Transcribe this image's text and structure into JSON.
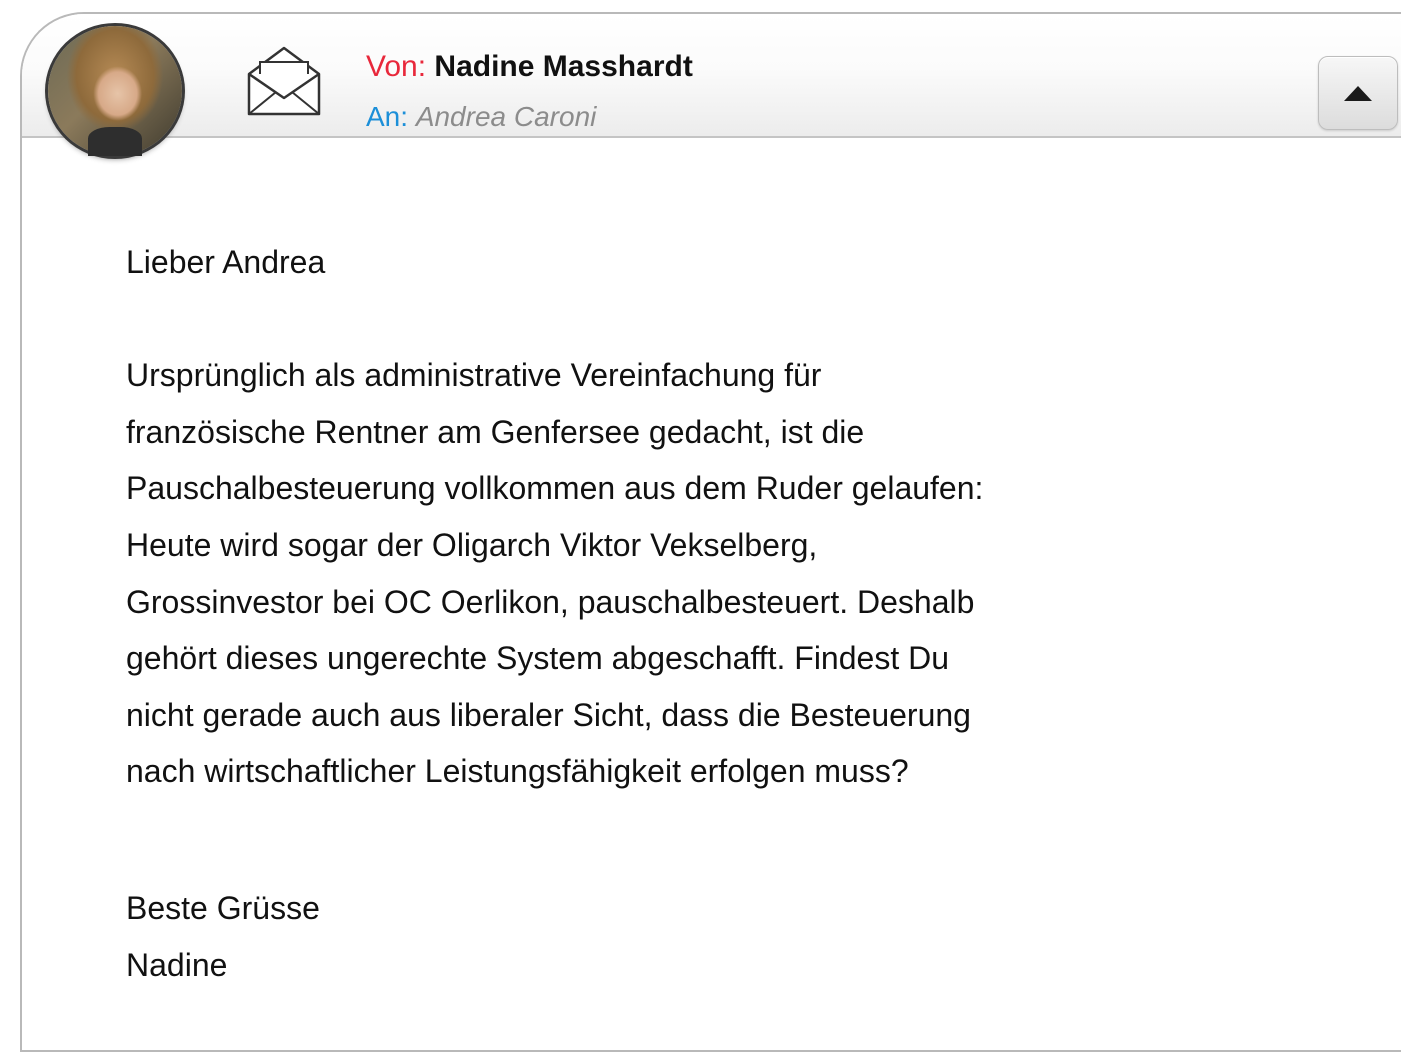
{
  "header": {
    "from_label": "Von:",
    "from_name": "Nadine Masshardt",
    "to_label": "An:",
    "to_name": "Andrea Caroni",
    "avatar_icon": "avatar-photo",
    "envelope_icon": "open-envelope-icon",
    "collapse_icon": "triangle-up-icon"
  },
  "message": {
    "greeting": "Lieber Andrea",
    "paragraph_lines": [
      "Ursprünglich als administrative Vereinfachung für",
      "französische Rentner am Genfersee gedacht, ist die",
      "Pauschalbesteuerung vollkommen aus dem Ruder gelaufen:",
      "Heute wird sogar der Oligarch Viktor Vekselberg,",
      "Grossinvestor bei OC Oerlikon, pauschalbesteuert. Deshalb",
      "gehört dieses ungerechte System abgeschafft. Findest Du",
      "nicht gerade auch aus liberaler Sicht, dass die Besteuerung",
      "nach wirtschaftlicher Leistungsfähigkeit erfolgen muss?"
    ],
    "closing": "Beste Grüsse",
    "signature": "Nadine"
  },
  "colors": {
    "from_label": "#e8283b",
    "to_label": "#1c8fd8",
    "to_name": "#8c8c8c",
    "border": "#b9b9b9"
  }
}
